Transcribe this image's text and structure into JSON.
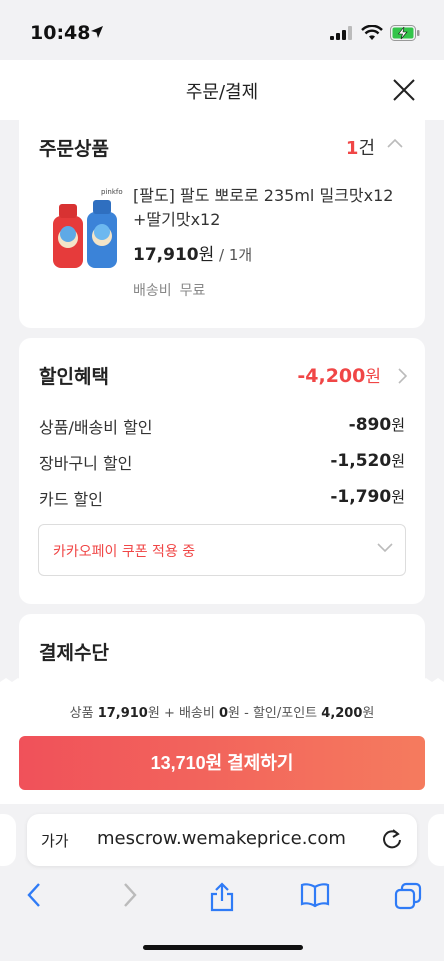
{
  "status_bar": {
    "time": "10:48"
  },
  "header": {
    "title": "주문/결제"
  },
  "order": {
    "title": "주문상품",
    "count": "1",
    "count_unit": "건",
    "product_name": "[팔도] 팔도 뽀로로 235ml 밀크맛x12 +딸기맛x12",
    "price": "17,910",
    "price_unit": "원",
    "qty": " / 1개",
    "shipping_label": "배송비",
    "shipping_value": "무료"
  },
  "discount": {
    "title": "할인혜택",
    "total": "-4,200",
    "total_unit": "원",
    "rows": [
      {
        "label": "상품/배송비 할인",
        "value": "-890",
        "unit": "원"
      },
      {
        "label": "장바구니 할인",
        "value": "-1,520",
        "unit": "원"
      },
      {
        "label": "카드 할인",
        "value": "-1,790",
        "unit": "원"
      }
    ],
    "coupon_text": "카카오페이 쿠폰 적용 중"
  },
  "payment": {
    "title": "결제수단"
  },
  "summary": {
    "p1": "상품 ",
    "v1": "17,910",
    "p2": "원 + 배송비 ",
    "v2": "0",
    "p3": "원 - 할인/포인트 ",
    "v3": "4,200",
    "p4": "원"
  },
  "pay_button": "13,710원 결제하기",
  "browser": {
    "aa": "가가",
    "url": "mescrow.wemakeprice.com"
  },
  "colors": {
    "accent": "#f04646",
    "button_start": "#f0515a",
    "button_end": "#f57b5e"
  }
}
